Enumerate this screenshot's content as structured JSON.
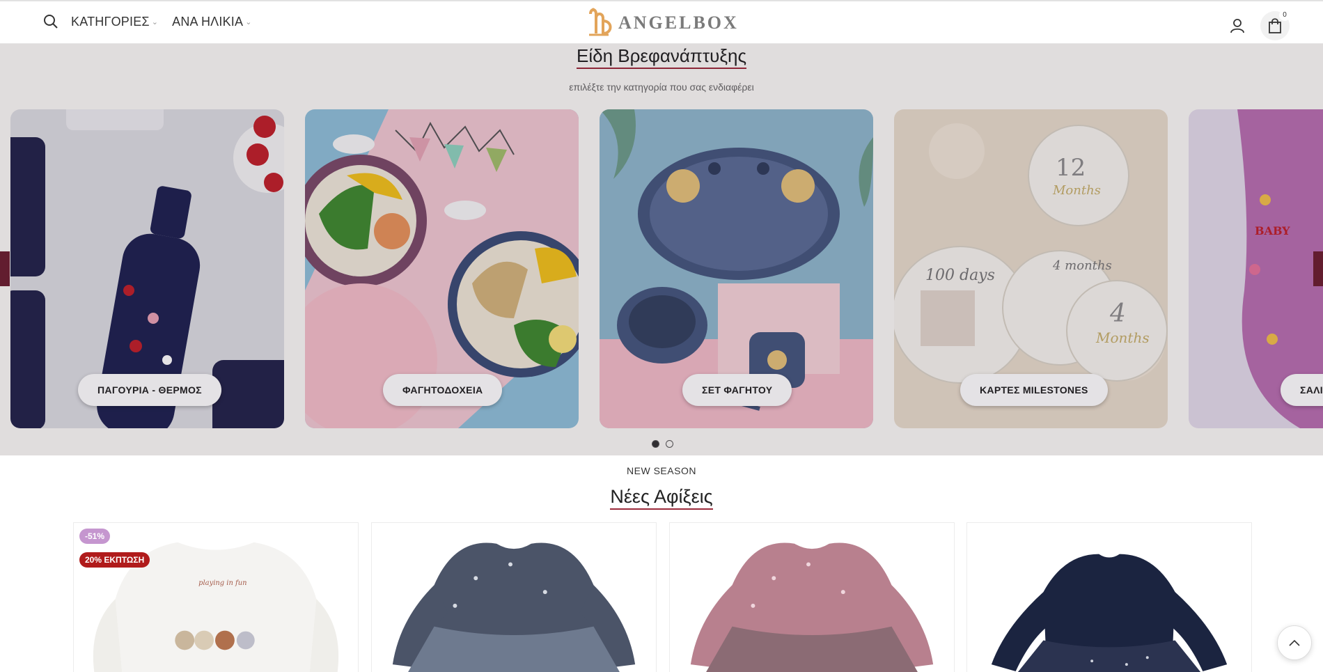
{
  "header": {
    "nav": [
      {
        "label": "ΚΑΤΗΓΟΡΙΕΣ"
      },
      {
        "label": "ΑΝΑ ΗΛΙΚΙΑ"
      }
    ],
    "logo_text": "ANGELBOX",
    "cart_count": "0",
    "icons": [
      "search-icon",
      "user-icon",
      "bag-icon"
    ]
  },
  "categories": {
    "title": "Είδη Βρεφανάπτυξης",
    "subtitle": "επιλέξτε την κατηγορία που σας ενδιαφέρει",
    "items": [
      {
        "label": "ΠΑΓΟΥΡΙΑ - ΘΕΡΜΟΣ"
      },
      {
        "label": "ΦΑΓΗΤΟΔΟΧΕΙΑ"
      },
      {
        "label": "ΣΕΤ ΦΑΓΗΤΟΥ"
      },
      {
        "label": "ΚΑΡΤΕΣ MILESTONES"
      },
      {
        "label": "ΣΑΛΙ"
      }
    ],
    "pages": 2,
    "current_page": 1
  },
  "new_arrivals": {
    "kicker": "NEW SEASON",
    "title": "Νέες Αφίξεις",
    "products": [
      {
        "discount_badge": "-51%",
        "promo_badge": "20% ΕΚΠΤΩΣΗ"
      },
      {},
      {},
      {}
    ]
  },
  "colors": {
    "accent": "#9b2a3a",
    "promo_red": "#b01b1b",
    "discount_purple": "#c596cf",
    "logo_gold": "#e2a45a"
  }
}
